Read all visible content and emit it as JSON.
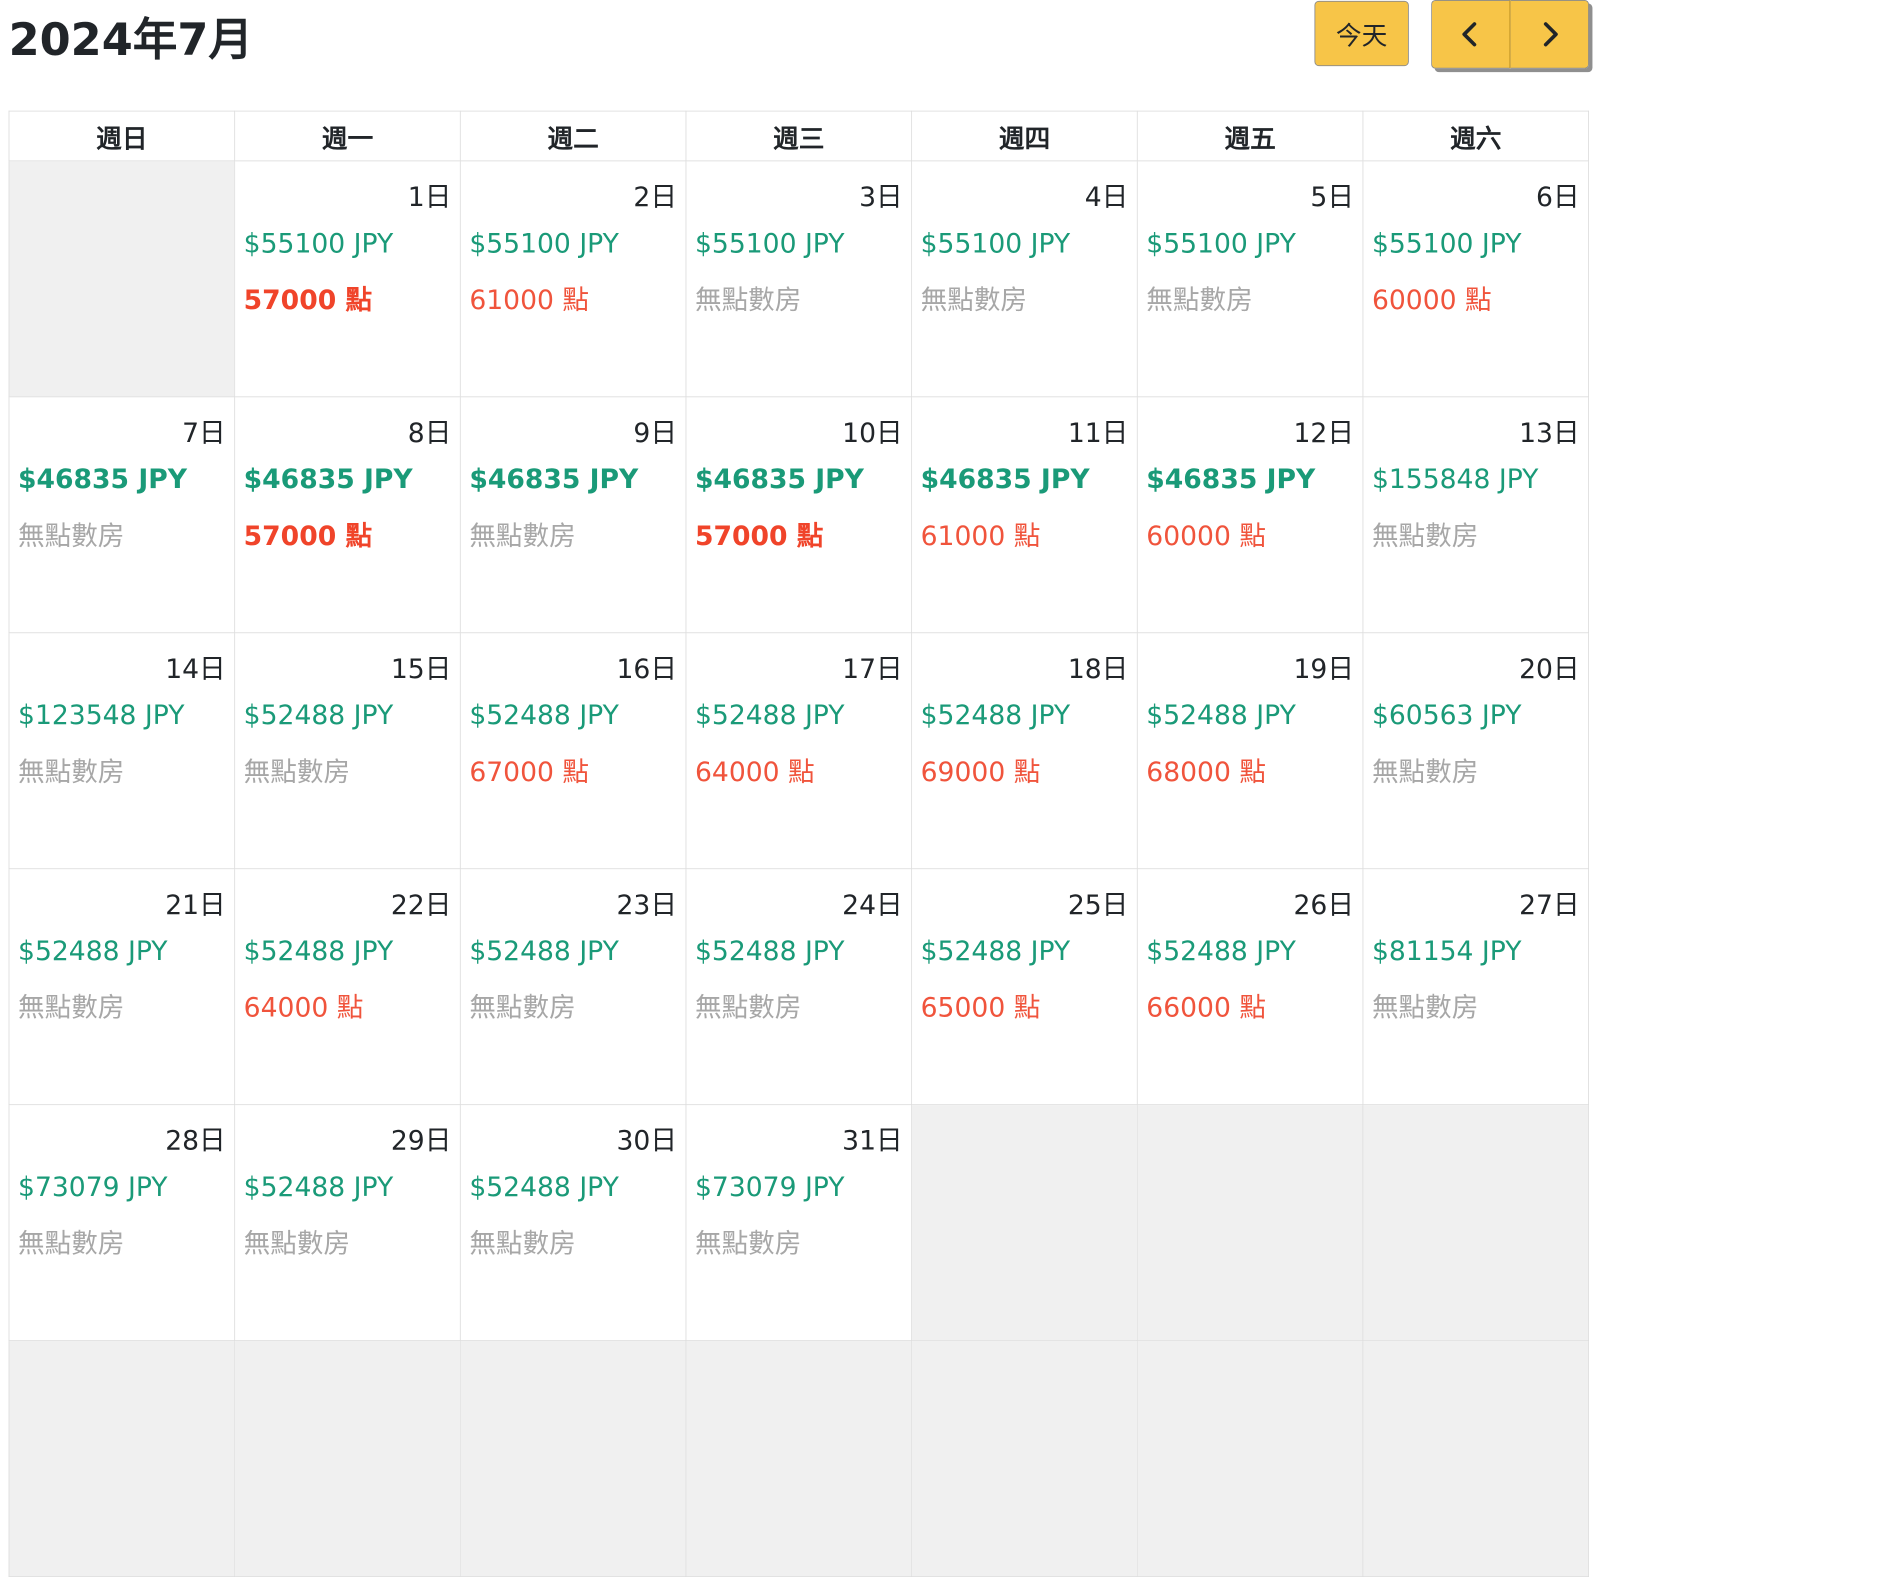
{
  "header": {
    "title": "2024年7月",
    "today_label": "今天",
    "prev_icon": "chevron-left-icon",
    "next_icon": "chevron-right-icon"
  },
  "colors": {
    "button": "#f7c548",
    "price": "#1a9a78",
    "points": "#f0543c",
    "points_bold": "#f0442a",
    "no_points": "#a7a7a7",
    "empty_cell": "#f0f0f0"
  },
  "weekdays": [
    "週日",
    "週一",
    "週二",
    "週三",
    "週四",
    "週五",
    "週六"
  ],
  "weeks": [
    [
      null,
      {
        "day": "1日",
        "price": "$55100 JPY",
        "price_bold": false,
        "points": "57000 點",
        "points_style": "bold"
      },
      {
        "day": "2日",
        "price": "$55100 JPY",
        "price_bold": false,
        "points": "61000 點",
        "points_style": "reg"
      },
      {
        "day": "3日",
        "price": "$55100 JPY",
        "price_bold": false,
        "points": "無點數房",
        "points_style": "none"
      },
      {
        "day": "4日",
        "price": "$55100 JPY",
        "price_bold": false,
        "points": "無點數房",
        "points_style": "none"
      },
      {
        "day": "5日",
        "price": "$55100 JPY",
        "price_bold": false,
        "points": "無點數房",
        "points_style": "none"
      },
      {
        "day": "6日",
        "price": "$55100 JPY",
        "price_bold": false,
        "points": "60000 點",
        "points_style": "reg"
      }
    ],
    [
      {
        "day": "7日",
        "price": "$46835 JPY",
        "price_bold": true,
        "points": "無點數房",
        "points_style": "none"
      },
      {
        "day": "8日",
        "price": "$46835 JPY",
        "price_bold": true,
        "points": "57000 點",
        "points_style": "bold"
      },
      {
        "day": "9日",
        "price": "$46835 JPY",
        "price_bold": true,
        "points": "無點數房",
        "points_style": "none"
      },
      {
        "day": "10日",
        "price": "$46835 JPY",
        "price_bold": true,
        "points": "57000 點",
        "points_style": "bold"
      },
      {
        "day": "11日",
        "price": "$46835 JPY",
        "price_bold": true,
        "points": "61000 點",
        "points_style": "reg"
      },
      {
        "day": "12日",
        "price": "$46835 JPY",
        "price_bold": true,
        "points": "60000 點",
        "points_style": "reg"
      },
      {
        "day": "13日",
        "price": "$155848 JPY",
        "price_bold": false,
        "points": "無點數房",
        "points_style": "none"
      }
    ],
    [
      {
        "day": "14日",
        "price": "$123548 JPY",
        "price_bold": false,
        "points": "無點數房",
        "points_style": "none"
      },
      {
        "day": "15日",
        "price": "$52488 JPY",
        "price_bold": false,
        "points": "無點數房",
        "points_style": "none"
      },
      {
        "day": "16日",
        "price": "$52488 JPY",
        "price_bold": false,
        "points": "67000 點",
        "points_style": "reg"
      },
      {
        "day": "17日",
        "price": "$52488 JPY",
        "price_bold": false,
        "points": "64000 點",
        "points_style": "reg"
      },
      {
        "day": "18日",
        "price": "$52488 JPY",
        "price_bold": false,
        "points": "69000 點",
        "points_style": "reg"
      },
      {
        "day": "19日",
        "price": "$52488 JPY",
        "price_bold": false,
        "points": "68000 點",
        "points_style": "reg"
      },
      {
        "day": "20日",
        "price": "$60563 JPY",
        "price_bold": false,
        "points": "無點數房",
        "points_style": "none"
      }
    ],
    [
      {
        "day": "21日",
        "price": "$52488 JPY",
        "price_bold": false,
        "points": "無點數房",
        "points_style": "none"
      },
      {
        "day": "22日",
        "price": "$52488 JPY",
        "price_bold": false,
        "points": "64000 點",
        "points_style": "reg"
      },
      {
        "day": "23日",
        "price": "$52488 JPY",
        "price_bold": false,
        "points": "無點數房",
        "points_style": "none"
      },
      {
        "day": "24日",
        "price": "$52488 JPY",
        "price_bold": false,
        "points": "無點數房",
        "points_style": "none"
      },
      {
        "day": "25日",
        "price": "$52488 JPY",
        "price_bold": false,
        "points": "65000 點",
        "points_style": "reg"
      },
      {
        "day": "26日",
        "price": "$52488 JPY",
        "price_bold": false,
        "points": "66000 點",
        "points_style": "reg"
      },
      {
        "day": "27日",
        "price": "$81154 JPY",
        "price_bold": false,
        "points": "無點數房",
        "points_style": "none"
      }
    ],
    [
      {
        "day": "28日",
        "price": "$73079 JPY",
        "price_bold": false,
        "points": "無點數房",
        "points_style": "none"
      },
      {
        "day": "29日",
        "price": "$52488 JPY",
        "price_bold": false,
        "points": "無點數房",
        "points_style": "none"
      },
      {
        "day": "30日",
        "price": "$52488 JPY",
        "price_bold": false,
        "points": "無點數房",
        "points_style": "none"
      },
      {
        "day": "31日",
        "price": "$73079 JPY",
        "price_bold": false,
        "points": "無點數房",
        "points_style": "none"
      },
      null,
      null,
      null
    ]
  ]
}
